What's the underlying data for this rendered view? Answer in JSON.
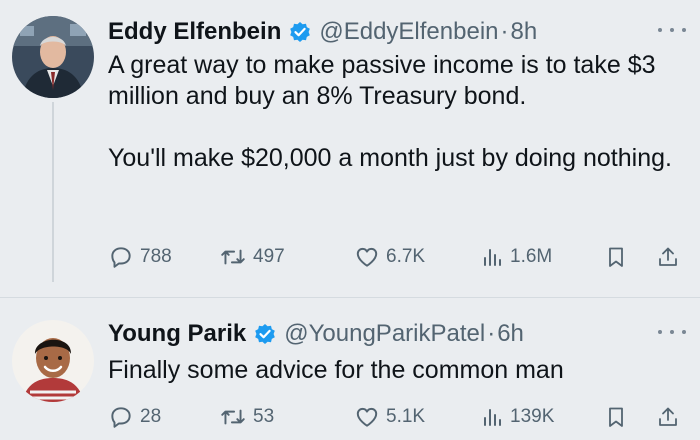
{
  "tweets": [
    {
      "author_name": "Eddy Elfenbein",
      "handle": "@EddyElfenbein",
      "separator": "·",
      "time": "8h",
      "paragraphs": [
        "A great way to make passive income is to take $3 million and buy an 8% Treasury bond.",
        "You'll make $20,000 a month just by doing nothing."
      ],
      "stats": {
        "replies": "788",
        "retweets": "497",
        "likes": "6.7K",
        "views": "1.6M"
      }
    },
    {
      "author_name": "Young Parik",
      "handle": "@YoungParikPatel",
      "separator": "·",
      "time": "6h",
      "paragraphs": [
        "Finally some advice for the common man"
      ],
      "stats": {
        "replies": "28",
        "retweets": "53",
        "likes": "5.1K",
        "views": "139K"
      }
    }
  ],
  "icons": {
    "verified": "verified-badge-icon",
    "reply": "reply-icon",
    "retweet": "retweet-icon",
    "like": "heart-icon",
    "views": "views-icon",
    "bookmark": "bookmark-icon",
    "share": "share-icon",
    "more": "more-icon"
  },
  "colors": {
    "verified": "#1d9bf0",
    "text": "#0f1419",
    "muted": "#536471",
    "background": "#eaedf0"
  }
}
